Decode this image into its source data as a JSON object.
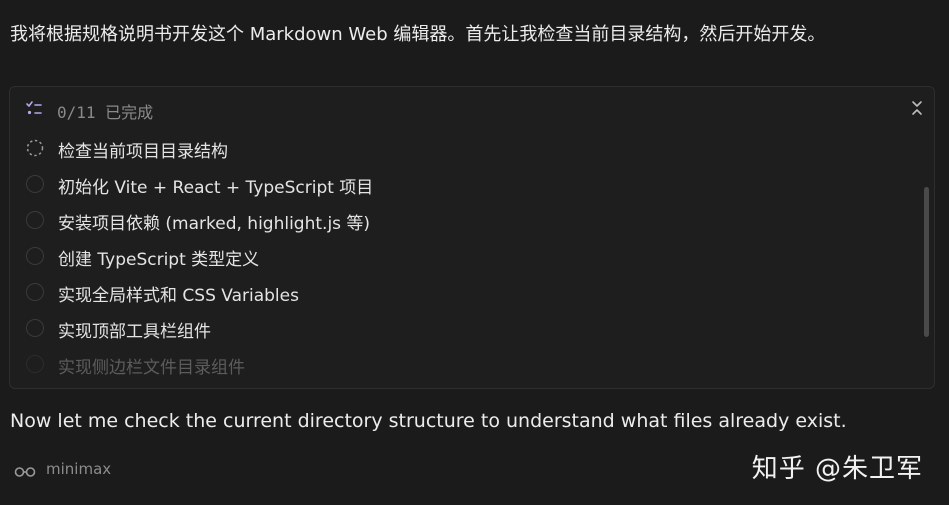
{
  "intro_text": "我将根据规格说明书开发这个 Markdown Web 编辑器。首先让我检查当前目录结构，然后开始开发。",
  "todo": {
    "progress": "0/11 已完成",
    "items": [
      {
        "label": "检查当前项目目录结构",
        "status": "in-progress"
      },
      {
        "label": "初始化 Vite + React + TypeScript 项目",
        "status": "pending"
      },
      {
        "label": "安装项目依赖 (marked, highlight.js 等)",
        "status": "pending"
      },
      {
        "label": "创建 TypeScript 类型定义",
        "status": "pending"
      },
      {
        "label": "实现全局样式和 CSS Variables",
        "status": "pending"
      },
      {
        "label": "实现顶部工具栏组件",
        "status": "pending"
      },
      {
        "label": "实现侧边栏文件目录组件",
        "status": "pending"
      }
    ]
  },
  "followup_text": "Now let me check the current directory structure to understand what files already exist.",
  "model_name": "minimax",
  "watermark": "知乎 @朱卫军",
  "icons": {
    "todo_list": "checklist-icon",
    "collapse": "collapse-icon",
    "model": "glasses-icon"
  },
  "colors": {
    "background": "#1b1b1b",
    "panel": "#1e1e1e",
    "accent_icon": "#b9a6e8"
  }
}
